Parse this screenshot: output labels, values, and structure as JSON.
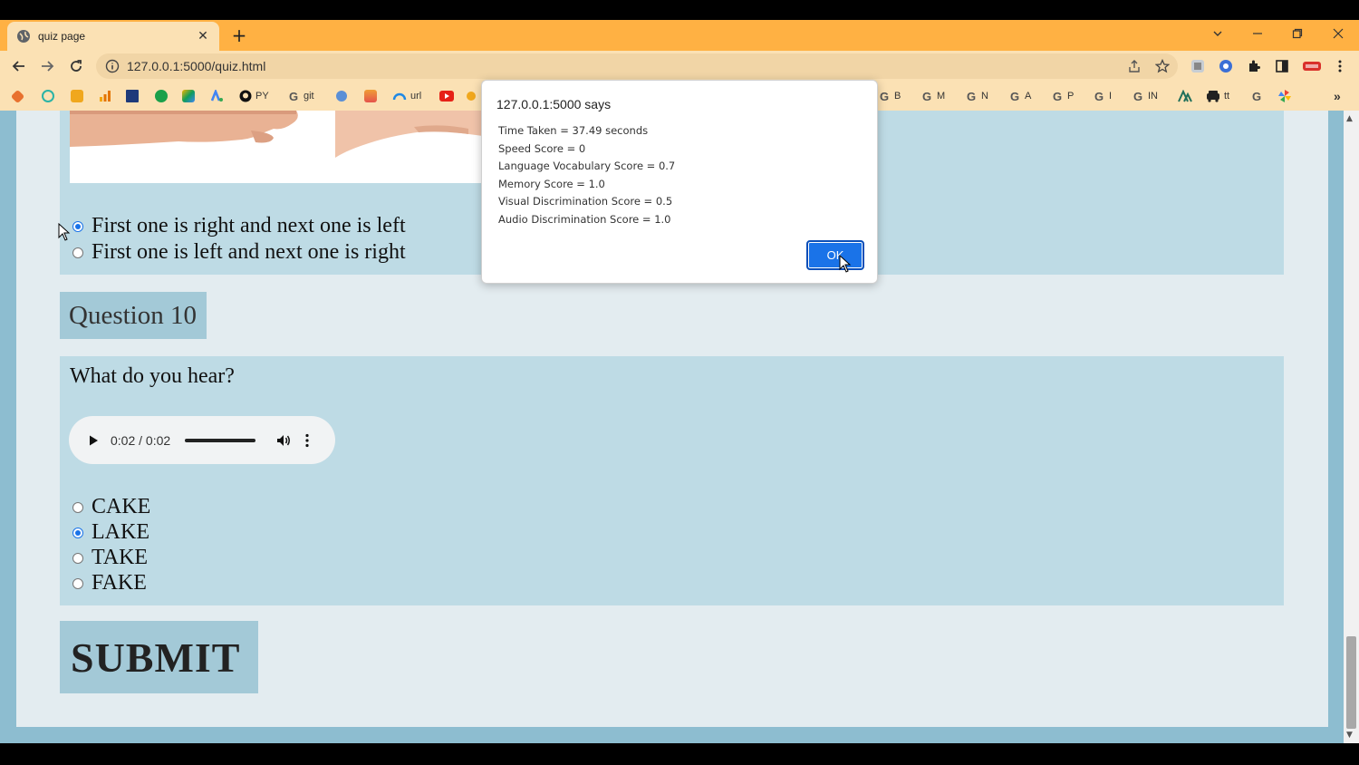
{
  "browser": {
    "tab_title": "quiz page",
    "new_tab_label": "+",
    "url": "127.0.0.1:5000/quiz.html",
    "bookmarks": [
      {
        "label": "PY",
        "icon": "github-icon"
      },
      {
        "label": "git",
        "icon": "google-icon"
      },
      {
        "label": "url",
        "icon": "cloud-icon"
      },
      {
        "label": "B",
        "icon": "google-icon"
      },
      {
        "label": "M",
        "icon": "google-icon"
      },
      {
        "label": "N",
        "icon": "google-icon"
      },
      {
        "label": "A",
        "icon": "google-icon"
      },
      {
        "label": "P",
        "icon": "google-icon"
      },
      {
        "label": "I",
        "icon": "google-icon"
      },
      {
        "label": "IN",
        "icon": "google-icon"
      },
      {
        "label": "tt",
        "icon": "car-icon"
      }
    ],
    "bookmarks_overflow": "»"
  },
  "quiz": {
    "q9_options": [
      {
        "label": "First one is right and next one is left",
        "checked": true
      },
      {
        "label": "First one is left and next one is right",
        "checked": false
      }
    ],
    "q10": {
      "header": "Question 10",
      "prompt": "What do you hear?",
      "audio_time": "0:02 / 0:02",
      "options": [
        {
          "label": "CAKE",
          "checked": false
        },
        {
          "label": "LAKE",
          "checked": true
        },
        {
          "label": "TAKE",
          "checked": false
        },
        {
          "label": "FAKE",
          "checked": false
        }
      ]
    },
    "submit_label": "SUBMIT"
  },
  "dialog": {
    "title": "127.0.0.1:5000 says",
    "lines": [
      "Time Taken = 37.49 seconds",
      "Speed Score = 0",
      "Language Vocabulary Score = 0.7",
      "Memory Score = 1.0",
      "Visual Discrimination Score = 0.5",
      "Audio Discrimination Score = 1.0"
    ],
    "ok_label": "OK"
  },
  "colors": {
    "chrome_orange": "#ffb143",
    "chrome_light": "#fbe1b4",
    "panel_blue": "#bedbe5",
    "accent_blue": "#1a73e8"
  }
}
